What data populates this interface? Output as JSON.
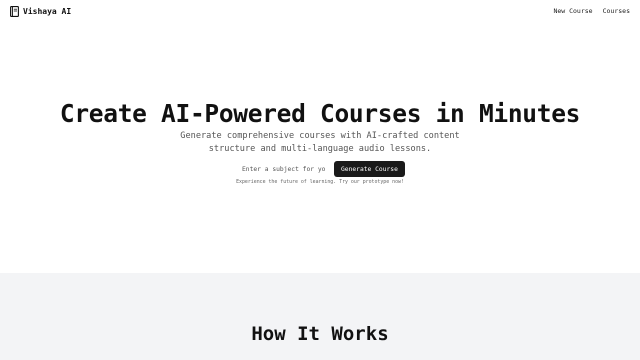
{
  "header": {
    "brand": "Vishaya AI",
    "brand_icon": "book-icon",
    "nav": [
      "New Course",
      "Courses"
    ]
  },
  "hero": {
    "title": "Create AI-Powered Courses in Minutes",
    "subtitle": "Generate comprehensive courses with AI-crafted content structure and multi-language audio lessons.",
    "input_placeholder": "Enter a subject for you",
    "input_value": "",
    "button_label": "Generate Course",
    "note": "Experience the future of learning. Try our prototype now!"
  },
  "how_it_works": {
    "title": "How It Works"
  },
  "colors": {
    "button_bg": "#1a1a1a",
    "section_bg": "#f3f4f6",
    "text": "#111111",
    "muted": "#555555"
  }
}
